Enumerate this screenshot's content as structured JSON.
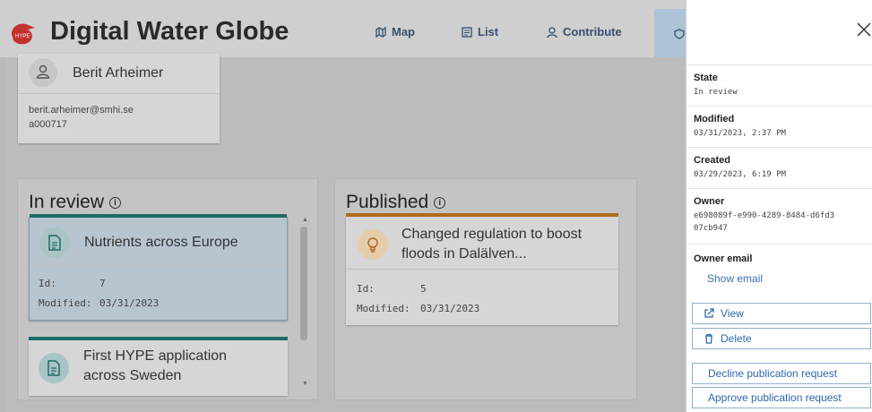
{
  "header": {
    "brand": "Digital Water Globe",
    "logo_text": "HYPE",
    "nav": [
      {
        "label": "Map",
        "icon": "map-icon"
      },
      {
        "label": "List",
        "icon": "list-icon"
      },
      {
        "label": "Contribute",
        "icon": "person-icon"
      }
    ]
  },
  "user": {
    "name": "Berit Arheimer",
    "email": "berit.arheimer@smhi.se",
    "id": "a000717"
  },
  "in_review": {
    "title": "In review",
    "items": [
      {
        "title": "Nutrients across Europe",
        "id_label": "Id:",
        "id": "7",
        "modified_label": "Modified:",
        "modified": "03/31/2023"
      },
      {
        "title": "First HYPE application across Sweden"
      }
    ]
  },
  "published": {
    "title": "Published",
    "items": [
      {
        "title": "Changed regulation to boost floods in Dalälven...",
        "id_label": "Id:",
        "id": "5",
        "modified_label": "Modified:",
        "modified": "03/31/2023"
      }
    ]
  },
  "drawer": {
    "state_label": "State",
    "state": "In review",
    "modified_label": "Modified",
    "modified": "03/31/2023, 2:37 PM",
    "created_label": "Created",
    "created": "03/29/2023, 6:19 PM",
    "owner_label": "Owner",
    "owner": "e698089f-e990-4289-8484-d6fd307cb947",
    "owner_email_label": "Owner email",
    "show_email": "Show email",
    "view_label": "View",
    "delete_label": "Delete",
    "decline_label": "Decline publication request",
    "approve_label": "Approve publication request"
  },
  "colors": {
    "review_accent": "#1e6b68",
    "published_accent": "#b06a1e",
    "link": "#3a73b5"
  }
}
